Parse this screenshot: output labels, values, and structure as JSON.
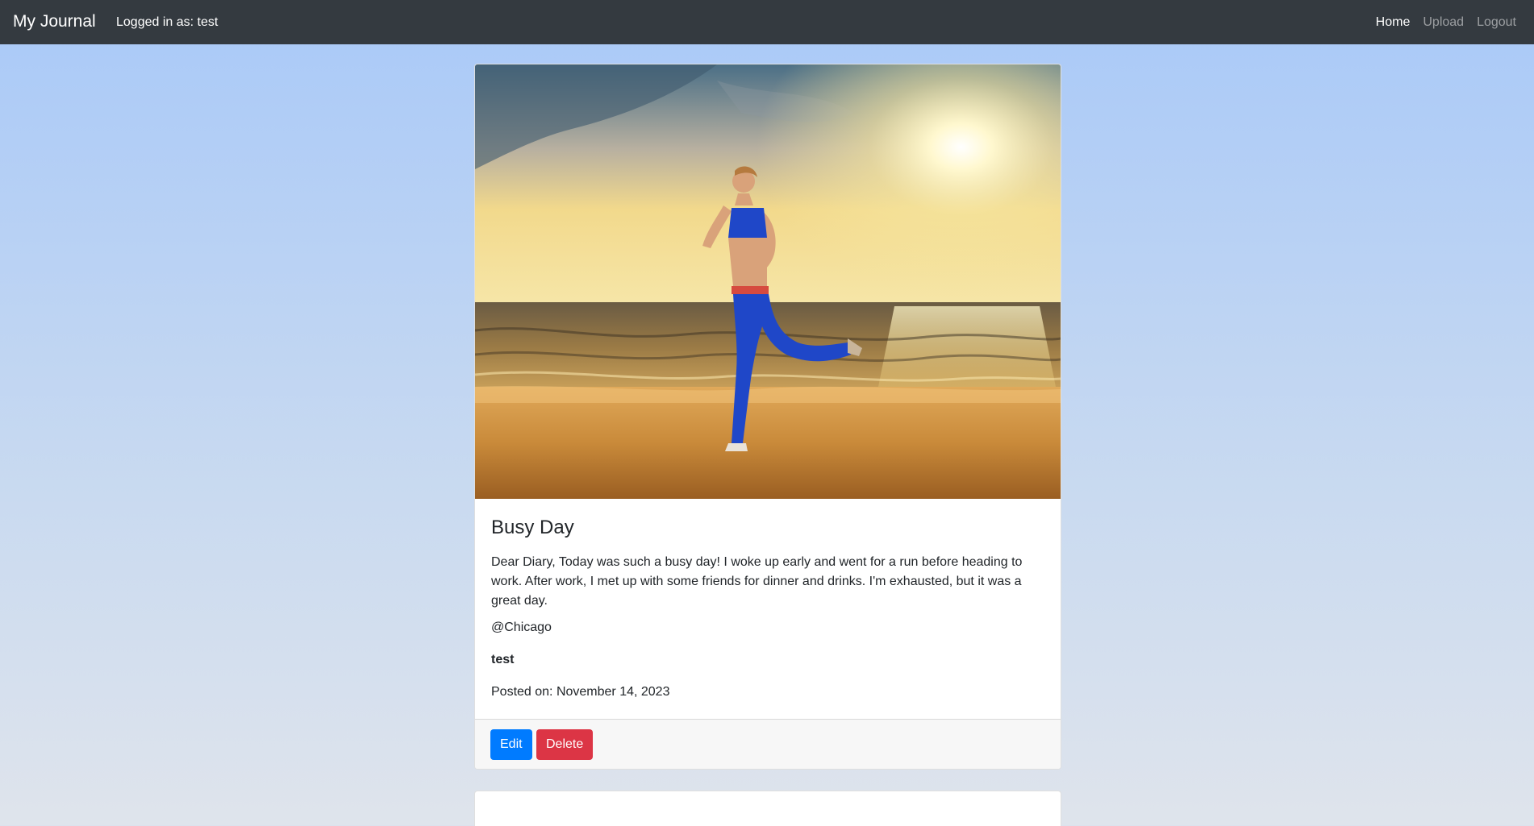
{
  "navbar": {
    "brand": "My Journal",
    "logged_in": "Logged in as: test",
    "links": [
      {
        "label": "Home",
        "active": true
      },
      {
        "label": "Upload",
        "active": false
      },
      {
        "label": "Logout",
        "active": false
      }
    ]
  },
  "entries": [
    {
      "image_alt": "Woman running on a beach at sunset",
      "title": "Busy Day",
      "content": "Dear Diary, Today was such a busy day! I woke up early and went for a run before heading to work. After work, I met up with some friends for dinner and drinks. I'm exhausted, but it was a great day.",
      "location": "@Chicago",
      "author": "test",
      "posted_on": "Posted on: November 14, 2023",
      "edit_label": "Edit",
      "delete_label": "Delete"
    }
  ],
  "colors": {
    "navbar_bg": "#343a40",
    "edit_button": "#007bff",
    "delete_button": "#dc3545"
  }
}
